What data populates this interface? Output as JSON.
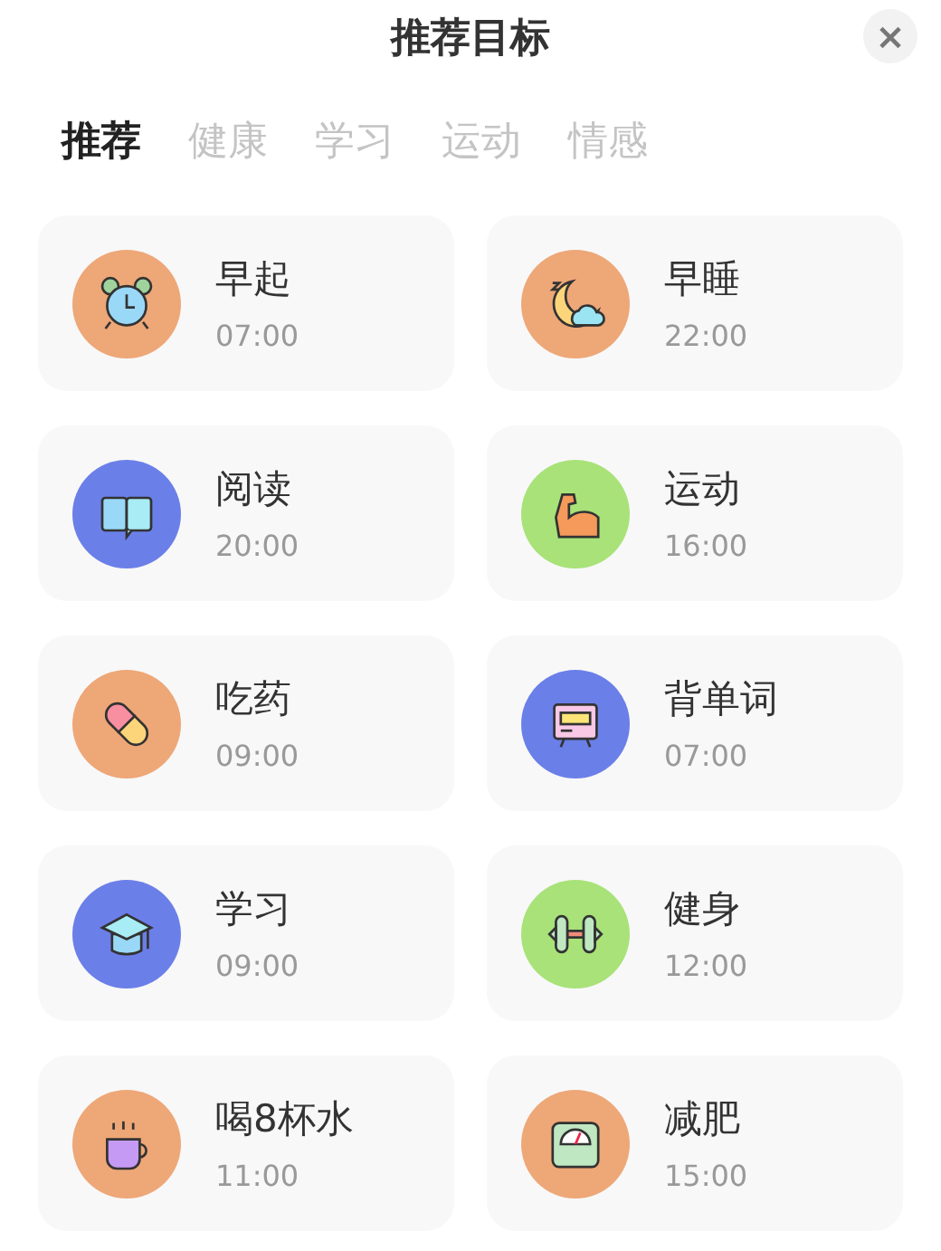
{
  "title": "推荐目标",
  "close": "×",
  "tabs": [
    {
      "label": "推荐",
      "selected": true
    },
    {
      "label": "健康",
      "selected": false
    },
    {
      "label": "学习",
      "selected": false
    },
    {
      "label": "运动",
      "selected": false
    },
    {
      "label": "情感",
      "selected": false
    }
  ],
  "goals": [
    {
      "name": "早起",
      "time": "07:00",
      "kind": "alarm",
      "color": "#eea777"
    },
    {
      "name": "早睡",
      "time": "22:00",
      "kind": "sleep",
      "color": "#eea777"
    },
    {
      "name": "阅读",
      "time": "20:00",
      "kind": "book",
      "color": "#6b7fe8"
    },
    {
      "name": "运动",
      "time": "16:00",
      "kind": "muscle",
      "color": "#a8e278"
    },
    {
      "name": "吃药",
      "time": "09:00",
      "kind": "pill",
      "color": "#eea777"
    },
    {
      "name": "背单词",
      "time": "07:00",
      "kind": "board",
      "color": "#6b7fe8"
    },
    {
      "name": "学习",
      "time": "09:00",
      "kind": "cap",
      "color": "#6b7fe8"
    },
    {
      "name": "健身",
      "time": "12:00",
      "kind": "dumbbell",
      "color": "#a8e278"
    },
    {
      "name": "喝8杯水",
      "time": "11:00",
      "kind": "cup",
      "color": "#eea777"
    },
    {
      "name": "减肥",
      "time": "15:00",
      "kind": "scale",
      "color": "#eea777"
    }
  ]
}
